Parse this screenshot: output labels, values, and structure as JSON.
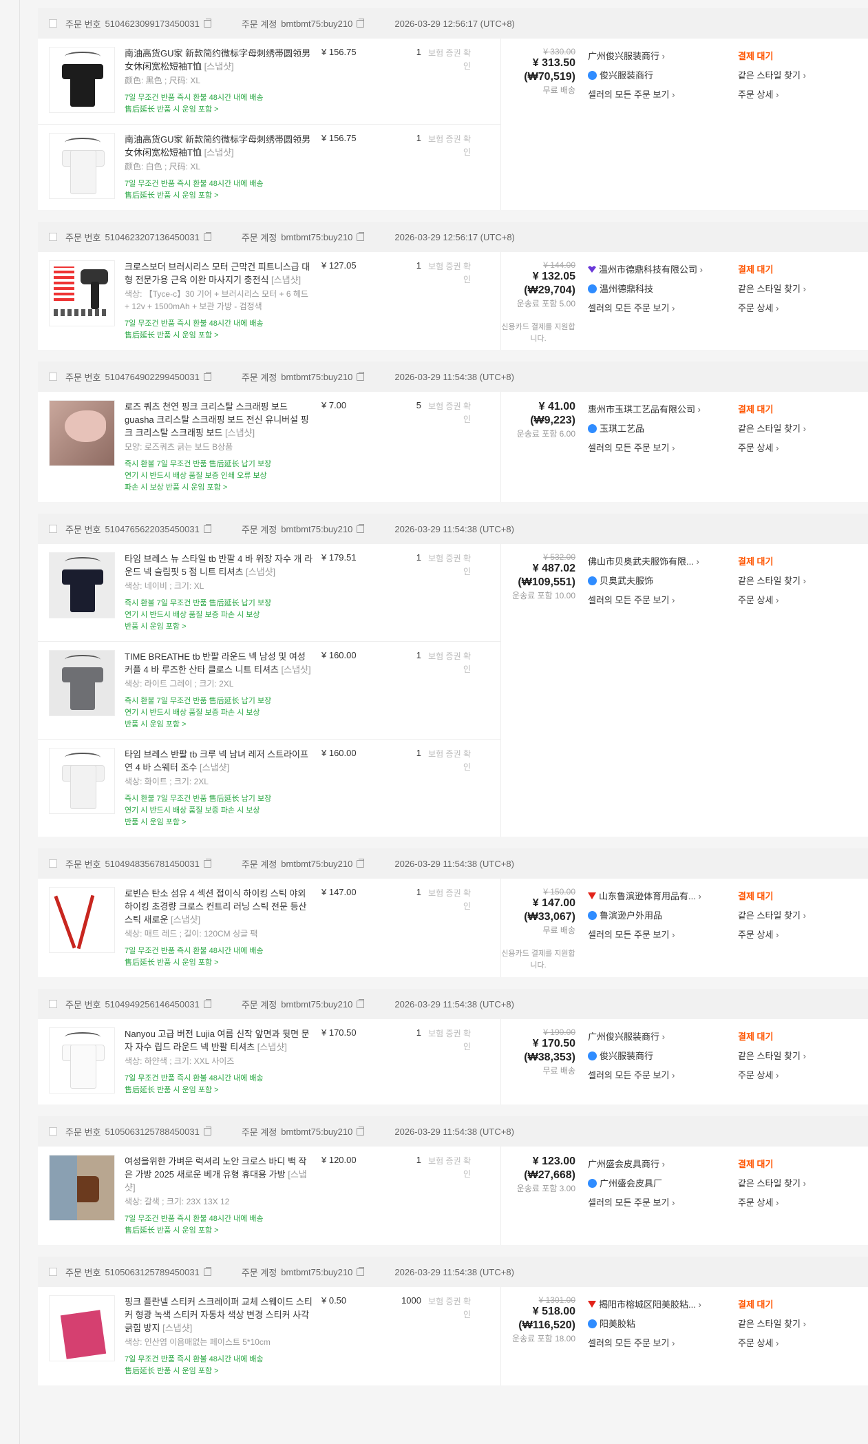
{
  "labels": {
    "order_no": "주문 번호",
    "order_account": "주문 계정",
    "insurance": "보험 증권 확인",
    "view_all": "셀러의 모든 주문 보기",
    "same_style": "같은 스타일 찾기",
    "detail": "주문 상세",
    "status": "결제 대기",
    "snapshot": "[스냅샷]"
  },
  "orders": [
    {
      "no": "5104623099173450031",
      "account": "bmtbmt75:buy210",
      "time": "2026-03-29 12:56:17 (UTC+8)",
      "orig": "¥ 330.00",
      "total": "¥ 313.50",
      "krw": "(₩70,519)",
      "ship": "무료 배송",
      "note": "",
      "seller": "广州俊兴服装商行",
      "seller_icon": "none",
      "shop": "俊兴服装商行",
      "items": [
        {
          "title": "南油高货GU家 新款简约微标字母刺绣帯圆领男女休闲宽松短袖T恤",
          "spec": "颜色: 黑色 ;  尺码: XL",
          "price": "¥ 156.75",
          "qty": "1",
          "tags1": "7일 무조건 반품  즉시 환불  48시간 내에 배송",
          "tags2": "售后延长  반품 시 운임 포함 >",
          "tags3": "",
          "thumb": "black-shirt"
        },
        {
          "title": "南油高货GU家 新款简约微标字母刺绣帯圆领男女休闲宽松短袖T恤",
          "spec": "颜色: 白色 ;  尺码: XL",
          "price": "¥ 156.75",
          "qty": "1",
          "tags1": "7일 무조건 반품  즉시 환불  48시간 내에 배송",
          "tags2": "售后延长  반품 시 운임 포함 >",
          "tags3": "",
          "thumb": "white-shirt"
        }
      ]
    },
    {
      "no": "5104623207136450031",
      "account": "bmtbmt75:buy210",
      "time": "2026-03-29 12:56:17 (UTC+8)",
      "orig": "¥ 144.00",
      "total": "¥ 132.05",
      "krw": "(₩29,704)",
      "ship": "운송료 포함 5.00",
      "note": "신용카드 결제를 지원합니다.",
      "seller": "温州市德鼎科技有限公司",
      "seller_icon": "crown",
      "shop": "温州德鼎科技",
      "items": [
        {
          "title": "크로스보더 브러시리스 모터 근막건 피트니스급 대형 전문가용 근육 이완 마사지기 충전식",
          "spec": "색상: 【Tyce-c】30 기어 + 브러시리스 모터 + 6 헤드 + 12v + 1500mAh + 보관 가방 - 검정색",
          "price": "¥ 127.05",
          "qty": "1",
          "tags1": "7일 무조건 반품  즉시 환불  48시간 내에 배송",
          "tags2": "售后延长  반품 시 운임 포함 >",
          "tags3": "",
          "thumb": "massage-gun"
        }
      ]
    },
    {
      "no": "5104764902299450031",
      "account": "bmtbmt75:buy210",
      "time": "2026-03-29 11:54:38 (UTC+8)",
      "orig": "",
      "total": "¥ 41.00",
      "krw": "(₩9,223)",
      "ship": "운송료 포함 6.00",
      "note": "",
      "seller": "惠州市玉琪工艺品有限公司",
      "seller_icon": "none",
      "shop": "玉琪工艺品",
      "items": [
        {
          "title": "로즈 쿼츠 천연 핑크 크리스탈 스크래핑 보드 guasha 크리스탈 스크래핑 보드 전신 유니버설 핑크 크리스탈 스크래핑 보드",
          "spec": "모양: 로즈쿼츠 긁는 보드 B상품",
          "price": "¥ 7.00",
          "qty": "5",
          "tags1": "즉시 환불  7일 무조건 반품  售后延长  납기 보장",
          "tags2": "연기 시 반드시 배상  품질 보증  인쇄 오류 보상",
          "tags3": "파손 시 보상  반품 시 운임 포함 >",
          "thumb": "guasha"
        }
      ]
    },
    {
      "no": "5104765622035450031",
      "account": "bmtbmt75:buy210",
      "time": "2026-03-29 11:54:38 (UTC+8)",
      "orig": "¥ 532.00",
      "total": "¥ 487.02",
      "krw": "(₩109,551)",
      "ship": "운송료 포함 10.00",
      "note": "",
      "seller": "佛山市贝奥武夫服饰有限...",
      "seller_icon": "none",
      "shop": "贝奥武夫服饰",
      "items": [
        {
          "title": "타임 브레스 뉴 스타일 tb 반팔 4 바 위장 자수 개 라운드 넥 슬림핏 5 점 니트 티셔츠",
          "spec": "색상: 네이비 ;  크기: XL",
          "price": "¥ 179.51",
          "qty": "1",
          "tags1": "즉시 환불  7일 무조건 반품  售后延长  납기 보장",
          "tags2": "연기 시 반드시 배상  품질 보증  파손 시 보상",
          "tags3": "반품 시 운임 포함 >",
          "thumb": "navy-shirt"
        },
        {
          "title": "TIME BREATHE tb 반팔 라운드 넥 남성 및 여성 커플 4 바 루즈한 산타 클로스 니트 티셔츠",
          "spec": "색상: 라이트 그레이 ;  크기: 2XL",
          "price": "¥ 160.00",
          "qty": "1",
          "tags1": "즉시 환불  7일 무조건 반품  售后延长  납기 보장",
          "tags2": "연기 시 반드시 배상  품질 보증  파손 시 보상",
          "tags3": "반품 시 운임 포함 >",
          "thumb": "grey-shirt"
        },
        {
          "title": "타임 브레스 반팔 tb 크루 넥 남녀 레저 스트라이프 연 4 바 스웨터 조수",
          "spec": "색상: 화이트 ;  크기: 2XL",
          "price": "¥ 160.00",
          "qty": "1",
          "tags1": "즉시 환불  7일 무조건 반품  售后延长  납기 보장",
          "tags2": "연기 시 반드시 배상  품질 보증  파손 시 보상",
          "tags3": "반품 시 운임 포함 >",
          "thumb": "white-stripe-shirt"
        }
      ]
    },
    {
      "no": "5104948356781450031",
      "account": "bmtbmt75:buy210",
      "time": "2026-03-29 11:54:38 (UTC+8)",
      "orig": "¥ 150.00",
      "total": "¥ 147.00",
      "krw": "(₩33,067)",
      "ship": "무료 배송",
      "note": "신용카드 결제를 지원합니다.",
      "seller": "山东鲁滨逊体育用品有...",
      "seller_icon": "tmall",
      "shop": "鲁滨逊户外用品",
      "items": [
        {
          "title": "로빈슨 탄소 섬유 4 섹션 접이식 하이킹 스틱 야외 하이킹 초경량 크로스 컨트리 러닝 스틱 전문 등산 스틱 새로운",
          "spec": "색상: 매트 레드 ;  길이: 120CM 싱글 팩",
          "price": "¥ 147.00",
          "qty": "1",
          "tags1": "7일 무조건 반품  즉시 환불  48시간 내에 배송",
          "tags2": "售后延长  반품 시 운임 포함 >",
          "tags3": "",
          "thumb": "poles"
        }
      ]
    },
    {
      "no": "5104949256146450031",
      "account": "bmtbmt75:buy210",
      "time": "2026-03-29 11:54:38 (UTC+8)",
      "orig": "¥ 190.00",
      "total": "¥ 170.50",
      "krw": "(₩38,353)",
      "ship": "무료 배송",
      "note": "",
      "seller": "广州俊兴服装商行",
      "seller_icon": "none",
      "shop": "俊兴服装商行",
      "items": [
        {
          "title": "Nanyou 고급 버전 Lujia 여름 신작 앞면과 뒷면 문자 자수 립드 라운드 넥 반팔 티셔츠",
          "spec": "색상: 하얀색 ;  크기: XXL 사이즈",
          "price": "¥ 170.50",
          "qty": "1",
          "tags1": "7일 무조건 반품  즉시 환불  48시간 내에 배송",
          "tags2": "售后延长  반품 시 운임 포함 >",
          "tags3": "",
          "thumb": "white-plain-shirt"
        }
      ]
    },
    {
      "no": "5105063125788450031",
      "account": "bmtbmt75:buy210",
      "time": "2026-03-29 11:54:38 (UTC+8)",
      "orig": "",
      "total": "¥ 123.00",
      "krw": "(₩27,668)",
      "ship": "운송료 포함 3.00",
      "note": "",
      "seller": "广州盛会皮具商行",
      "seller_icon": "none",
      "shop": "广州盛会皮具厂",
      "items": [
        {
          "title": "여성을위한 가벼운 럭셔리 노안 크로스 바디 백 작은 가방 2025 새로운 베개 유형 휴대용 가방",
          "spec": "색상: 갈색 ;  크기: 23X 13X 12",
          "price": "¥ 120.00",
          "qty": "1",
          "tags1": "7일 무조건 반품  즉시 환불  48시간 내에 배송",
          "tags2": "售后延长  반품 시 운임 포함 >",
          "tags3": "",
          "thumb": "bag"
        }
      ]
    },
    {
      "no": "5105063125789450031",
      "account": "bmtbmt75:buy210",
      "time": "2026-03-29 11:54:38 (UTC+8)",
      "orig": "¥ 1301.00",
      "total": "¥ 518.00",
      "krw": "(₩116,520)",
      "ship": "운송료 포함 18.00",
      "note": "",
      "seller": "揭阳市榕城区阳美胶粘...",
      "seller_icon": "tmall",
      "shop": "阳美胶粘",
      "items": [
        {
          "title": "핑크 플란넬 스티커 스크레이퍼 교체 스웨이드 스티커 형광 녹색 스티커 자동차 색상 변경 스티커 사각 긁힘 방지",
          "spec": "색상: 인산염 이음매없는 페이스트 5*10cm",
          "price": "¥ 0.50",
          "qty": "1000",
          "tags1": "7일 무조건 반품  즉시 환불  48시간 내에 배송",
          "tags2": "售后延长  반품 시 운임 포함 >",
          "tags3": "",
          "thumb": "felt"
        }
      ]
    }
  ]
}
